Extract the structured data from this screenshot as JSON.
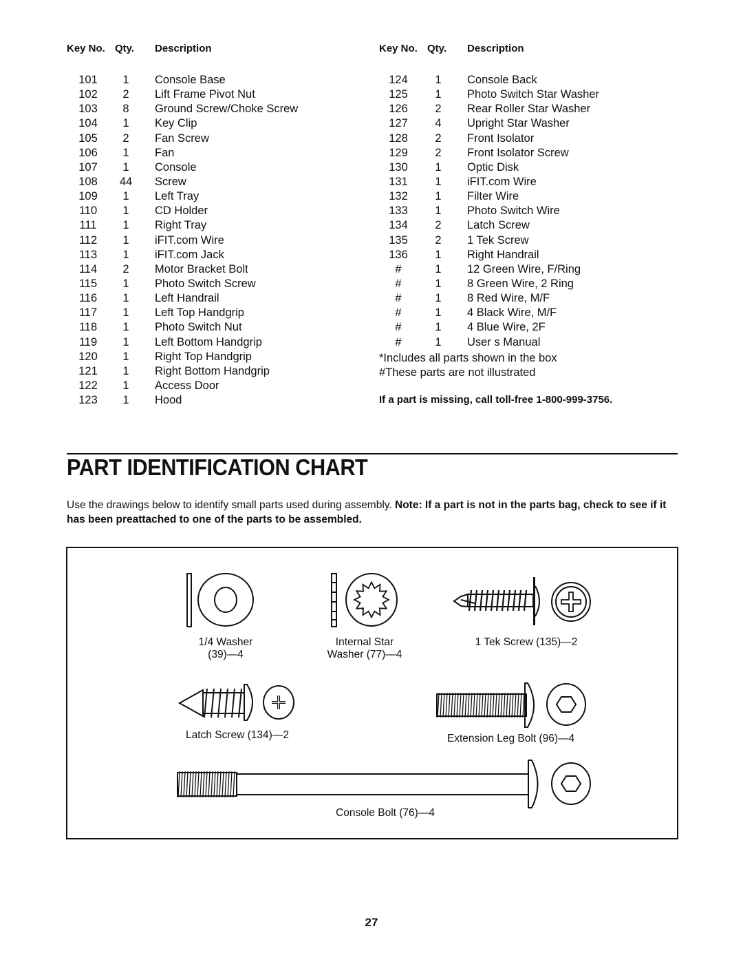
{
  "parts_list": {
    "headers": {
      "key": "Key No.",
      "qty": "Qty.",
      "desc": "Description"
    },
    "left": [
      {
        "key": "101",
        "qty": "1",
        "desc": "Console Base"
      },
      {
        "key": "102",
        "qty": "2",
        "desc": "Lift Frame Pivot Nut"
      },
      {
        "key": "103",
        "qty": "8",
        "desc": "Ground Screw/Choke Screw"
      },
      {
        "key": "104",
        "qty": "1",
        "desc": "Key Clip"
      },
      {
        "key": "105",
        "qty": "2",
        "desc": "Fan Screw"
      },
      {
        "key": "106",
        "qty": "1",
        "desc": "Fan"
      },
      {
        "key": "107",
        "qty": "1",
        "desc": "Console"
      },
      {
        "key": "108",
        "qty": "44",
        "desc": "Screw"
      },
      {
        "key": "109",
        "qty": "1",
        "desc": "Left Tray"
      },
      {
        "key": "110",
        "qty": "1",
        "desc": "CD Holder"
      },
      {
        "key": "111",
        "qty": "1",
        "desc": "Right Tray"
      },
      {
        "key": "112",
        "qty": "1",
        "desc": "iFIT.com Wire"
      },
      {
        "key": "113",
        "qty": "1",
        "desc": "iFIT.com Jack"
      },
      {
        "key": "114",
        "qty": "2",
        "desc": "Motor Bracket Bolt"
      },
      {
        "key": "115",
        "qty": "1",
        "desc": "Photo Switch Screw"
      },
      {
        "key": "116",
        "qty": "1",
        "desc": "Left Handrail"
      },
      {
        "key": "117",
        "qty": "1",
        "desc": "Left Top Handgrip"
      },
      {
        "key": "118",
        "qty": "1",
        "desc": "Photo Switch Nut"
      },
      {
        "key": "119",
        "qty": "1",
        "desc": "Left Bottom Handgrip"
      },
      {
        "key": "120",
        "qty": "1",
        "desc": "Right Top Handgrip"
      },
      {
        "key": "121",
        "qty": "1",
        "desc": "Right Bottom Handgrip"
      },
      {
        "key": "122",
        "qty": "1",
        "desc": "Access Door"
      },
      {
        "key": "123",
        "qty": "1",
        "desc": "Hood"
      }
    ],
    "right": [
      {
        "key": "124",
        "qty": "1",
        "desc": "Console Back"
      },
      {
        "key": "125",
        "qty": "1",
        "desc": "Photo Switch Star Washer"
      },
      {
        "key": "126",
        "qty": "2",
        "desc": "Rear Roller Star Washer"
      },
      {
        "key": "127",
        "qty": "4",
        "desc": "Upright Star Washer"
      },
      {
        "key": "128",
        "qty": "2",
        "desc": "Front Isolator"
      },
      {
        "key": "129",
        "qty": "2",
        "desc": "Front Isolator Screw"
      },
      {
        "key": "130",
        "qty": "1",
        "desc": "Optic Disk"
      },
      {
        "key": "131",
        "qty": "1",
        "desc": "iFIT.com Wire"
      },
      {
        "key": "132",
        "qty": "1",
        "desc": "Filter Wire"
      },
      {
        "key": "133",
        "qty": "1",
        "desc": "Photo Switch Wire"
      },
      {
        "key": "134",
        "qty": "2",
        "desc": "Latch Screw"
      },
      {
        "key": "135",
        "qty": "2",
        "desc": "1  Tek Screw"
      },
      {
        "key": "136",
        "qty": "1",
        "desc": "Right Handrail"
      },
      {
        "key": "#",
        "qty": "1",
        "desc": "12  Green Wire, F/Ring"
      },
      {
        "key": "#",
        "qty": "1",
        "desc": "8  Green Wire, 2 Ring"
      },
      {
        "key": "#",
        "qty": "1",
        "desc": "8  Red Wire, M/F"
      },
      {
        "key": "#",
        "qty": "1",
        "desc": "4  Black Wire, M/F"
      },
      {
        "key": "#",
        "qty": "1",
        "desc": "4  Blue Wire, 2F"
      },
      {
        "key": "#",
        "qty": "1",
        "desc": "User s Manual"
      }
    ],
    "notes": [
      "*Includes all parts shown in the box",
      "#These parts are not illustrated"
    ],
    "missing_part": "If a part is missing, call toll-free 1-800-999-3756."
  },
  "chart": {
    "title": "PART IDENTIFICATION CHART",
    "intro_plain": "Use the drawings below to identify small parts used during assembly. ",
    "intro_bold": "Note: If a part is not in the parts bag, check to see if it has been preattached to one of the parts to be assembled.",
    "parts": {
      "washer": {
        "line1": "1/4  Washer",
        "line2": "(39)—4"
      },
      "star_washer": {
        "line1": "Internal Star",
        "line2": "Washer (77)—4"
      },
      "tek_screw": {
        "line1": "1  Tek Screw (135)—2"
      },
      "latch_screw": {
        "line1": "Latch Screw (134)—2"
      },
      "leg_bolt": {
        "line1": "Extension Leg Bolt (96)—4"
      },
      "console_bolt": {
        "line1": "Console Bolt (76)—4"
      }
    }
  },
  "page_number": "27"
}
